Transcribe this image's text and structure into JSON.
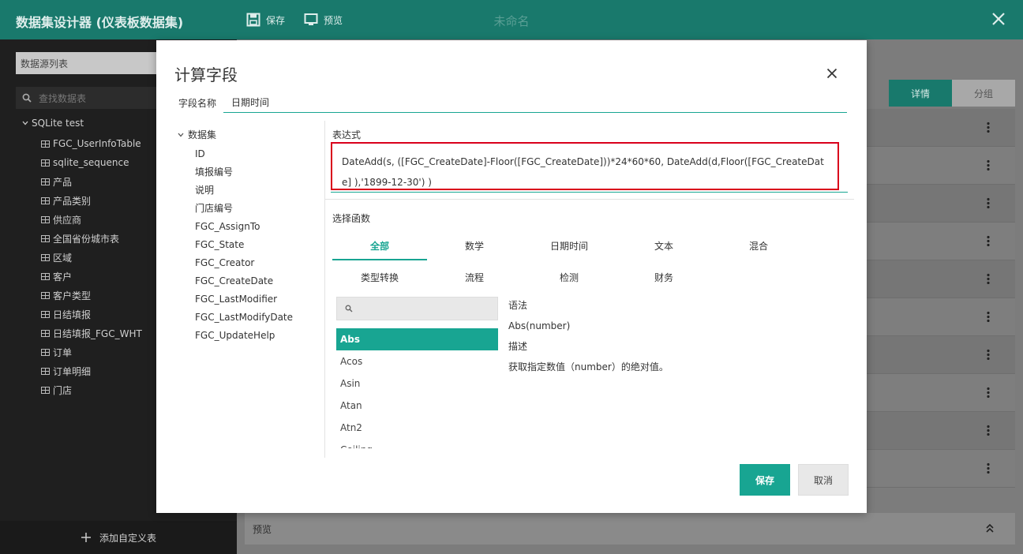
{
  "app": {
    "title": "数据集设计器 (仪表板数据集)",
    "save_label": "保存",
    "preview_label": "预览",
    "document_name": "未命名",
    "icons": {
      "save": "save-icon",
      "preview": "monitor-icon",
      "close": "close-icon"
    },
    "accent_color": "#18a592"
  },
  "sidebar": {
    "datasource_select": "数据源列表",
    "search_placeholder": "查找数据表",
    "root": "SQLite test",
    "tables": [
      "FGC_UserInfoTable",
      "sqlite_sequence",
      "产品",
      "产品类别",
      "供应商",
      "全国省份城市表",
      "区域",
      "客户",
      "客户类型",
      "日结填报",
      "日结填报_FGC_WHT",
      "订单",
      "订单明细",
      "门店"
    ],
    "add_custom_table": "添加自定义表"
  },
  "right_panel": {
    "tab_detail": "详情",
    "tab_group": "分组",
    "preview_label": "预览"
  },
  "modal": {
    "title": "计算字段",
    "field_name_label": "字段名称",
    "field_name_value": "日期时间",
    "dataset_root": "数据集",
    "fields": [
      "ID",
      "填报编号",
      "说明",
      "门店编号",
      "FGC_AssignTo",
      "FGC_State",
      "FGC_Creator",
      "FGC_CreateDate",
      "FGC_LastModifier",
      "FGC_LastModifyDate",
      "FGC_UpdateHelp"
    ],
    "expression_label": "表达式",
    "expression": "DateAdd(s, ([FGC_CreateDate]-Floor([FGC_CreateDate]))*24*60*60, DateAdd(d,Floor([FGC_CreateDate] ),'1899-12-30') )",
    "function_label": "选择函数",
    "categories_row1": [
      "全部",
      "数学",
      "日期时间",
      "文本",
      "混合"
    ],
    "categories_row2": [
      "类型转换",
      "流程",
      "检测",
      "财务"
    ],
    "active_category": "全部",
    "functions": [
      "Abs",
      "Acos",
      "Asin",
      "Atan",
      "Atn2",
      "Ceiling"
    ],
    "selected_function": "Abs",
    "syntax_label": "语法",
    "syntax_value": "Abs(number)",
    "description_label": "描述",
    "description_value": "获取指定数值（number）的绝对值。",
    "save_button": "保存",
    "cancel_button": "取消"
  }
}
